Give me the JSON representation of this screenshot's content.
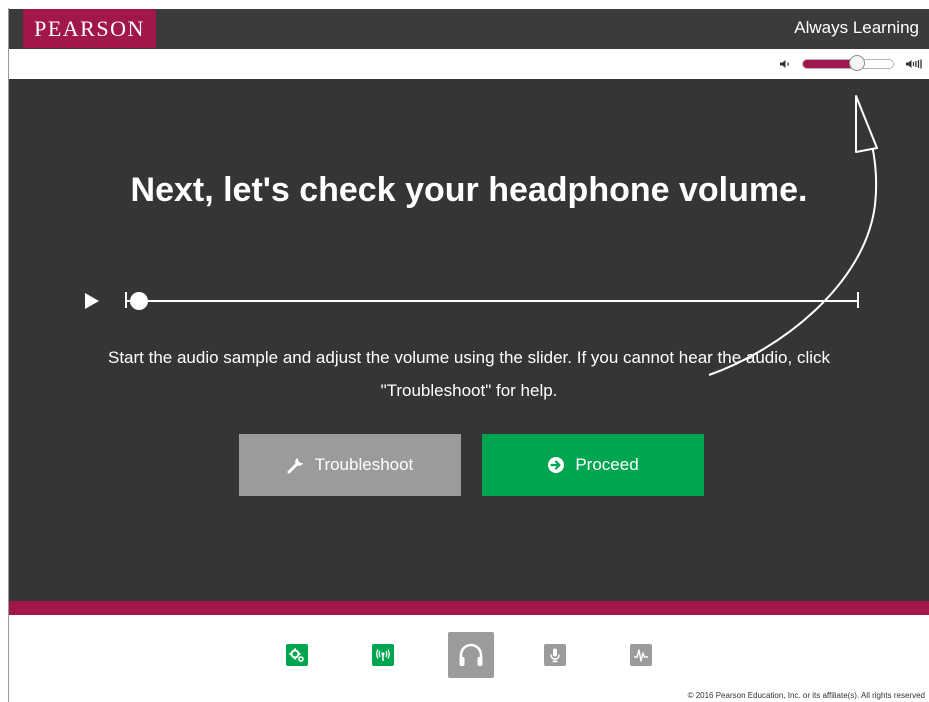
{
  "header": {
    "logo_text": "PEARSON",
    "tagline": "Always Learning"
  },
  "volume": {
    "level": 0.6,
    "low_icon": "speaker-low-icon",
    "high_icon": "speaker-high-icon"
  },
  "main": {
    "headline": "Next, let's check your headphone volume.",
    "audio_player": {
      "play_icon": "play-icon",
      "progress": 0.0
    },
    "instructions_line1": "Start the audio sample and adjust the volume using the slider. If you cannot hear the audio, click",
    "instructions_line2": "\"Troubleshoot\" for help.",
    "troubleshoot_label": "Troubleshoot",
    "troubleshoot_icon": "wrench-icon",
    "proceed_label": "Proceed",
    "proceed_icon": "arrow-circle-right-icon"
  },
  "steps": [
    {
      "icon": "gears-icon",
      "state": "complete"
    },
    {
      "icon": "wireless-icon",
      "state": "complete"
    },
    {
      "icon": "headphones-icon",
      "state": "current"
    },
    {
      "icon": "microphone-icon",
      "state": "pending"
    },
    {
      "icon": "waveform-icon",
      "state": "pending"
    }
  ],
  "footer": {
    "copyright": "© 2016 Pearson Education, Inc. or its affiliate(s). All rights reserved"
  },
  "colors": {
    "brand": "#a1164b",
    "header_bg": "#3b3b3b",
    "panel_bg": "#353535",
    "proceed": "#00a550",
    "troubleshoot": "#9b9b9b"
  }
}
